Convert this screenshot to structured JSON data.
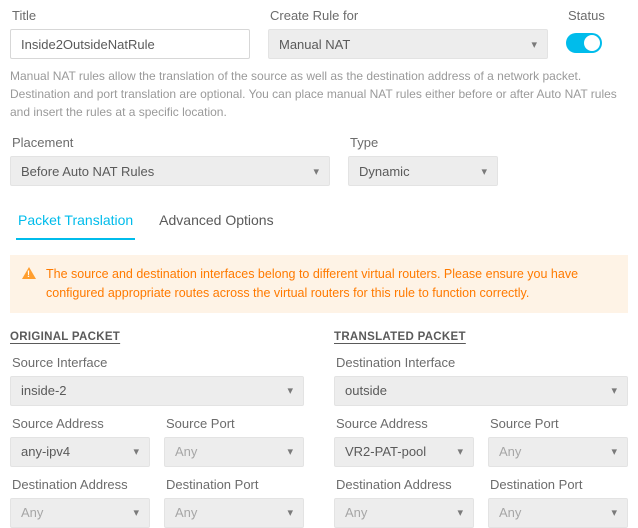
{
  "top": {
    "title_label": "Title",
    "title_value": "Inside2OutsideNatRule",
    "create_for_label": "Create Rule for",
    "create_for_value": "Manual NAT",
    "status_label": "Status"
  },
  "help": "Manual NAT rules allow the translation of the source as well as the destination address of a network packet. Destination and port translation are optional. You can place manual NAT rules either before or after Auto NAT rules and insert the rules at a specific location.",
  "placement": {
    "label": "Placement",
    "value": "Before Auto NAT Rules"
  },
  "type": {
    "label": "Type",
    "value": "Dynamic"
  },
  "tabs": {
    "packet": "Packet Translation",
    "advanced": "Advanced Options"
  },
  "alert": "The source and destination interfaces belong to different virtual routers. Please ensure you have configured appropriate routes across the virtual routers for this rule to function correctly.",
  "orig": {
    "head": "ORIGINAL PACKET",
    "src_if_label": "Source Interface",
    "src_if_value": "inside-2",
    "src_addr_label": "Source Address",
    "src_addr_value": "any-ipv4",
    "src_port_label": "Source Port",
    "src_port_value": "Any",
    "dst_addr_label": "Destination Address",
    "dst_addr_value": "Any",
    "dst_port_label": "Destination Port",
    "dst_port_value": "Any"
  },
  "trans": {
    "head": "TRANSLATED PACKET",
    "dst_if_label": "Destination Interface",
    "dst_if_value": "outside",
    "src_addr_label": "Source Address",
    "src_addr_value": "VR2-PAT-pool",
    "src_port_label": "Source Port",
    "src_port_value": "Any",
    "dst_addr_label": "Destination Address",
    "dst_addr_value": "Any",
    "dst_port_label": "Destination Port",
    "dst_port_value": "Any"
  }
}
